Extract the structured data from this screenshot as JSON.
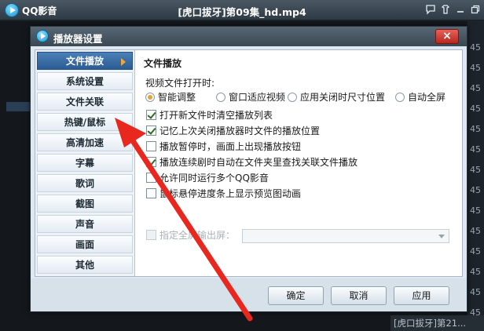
{
  "player": {
    "app_name": "QQ影音",
    "file_title": "[虎口拔牙]第09集_hd.mp4",
    "playlist_numbers": [
      "45",
      "45",
      "45",
      "45",
      "45",
      "45",
      "45",
      "45",
      "45",
      "45",
      "45",
      "45",
      "45",
      "45"
    ],
    "playlist_bottom_item": "[虎口拔牙]第21..."
  },
  "dialog": {
    "title": "播放器设置",
    "close_label": "×",
    "nav": [
      {
        "label": "文件播放",
        "active": true
      },
      {
        "label": "系统设置",
        "active": false
      },
      {
        "label": "文件关联",
        "active": false
      },
      {
        "label": "热键/鼠标",
        "active": false
      },
      {
        "label": "高清加速",
        "active": false
      },
      {
        "label": "字幕",
        "active": false
      },
      {
        "label": "歌词",
        "active": false
      },
      {
        "label": "截图",
        "active": false
      },
      {
        "label": "声音",
        "active": false
      },
      {
        "label": "画面",
        "active": false
      },
      {
        "label": "其他",
        "active": false
      }
    ],
    "section_title": "文件播放",
    "open_label": "视频文件打开时:",
    "radios": [
      {
        "label": "智能调整",
        "selected": true
      },
      {
        "label": "窗口适应视频",
        "selected": false
      },
      {
        "label": "应用关闭时尺寸位置",
        "selected": false
      },
      {
        "label": "自动全屏",
        "selected": false
      }
    ],
    "checks": [
      {
        "label": "打开新文件时清空播放列表",
        "checked": true
      },
      {
        "label": "记忆上次关闭播放器时文件的播放位置",
        "checked": true
      },
      {
        "label": "播放暂停时，画面上出现播放按钮",
        "checked": false
      },
      {
        "label": "播放连续剧时自动在文件夹里查找关联文件播放",
        "checked": true
      },
      {
        "label": "允许同时运行多个QQ影音",
        "checked": false
      },
      {
        "label": "鼠标悬停进度条上显示预览图动画",
        "checked": false
      }
    ],
    "monitor_option": {
      "label": "指定全屏输出屏：",
      "checked": false,
      "disabled": true
    },
    "buttons": {
      "ok": "确定",
      "cancel": "取消",
      "apply": "应用"
    }
  },
  "colors": {
    "annotation_arrow": "#e8271f",
    "nav_active": "#2c5c93",
    "radio_dot": "#e2a33a"
  }
}
